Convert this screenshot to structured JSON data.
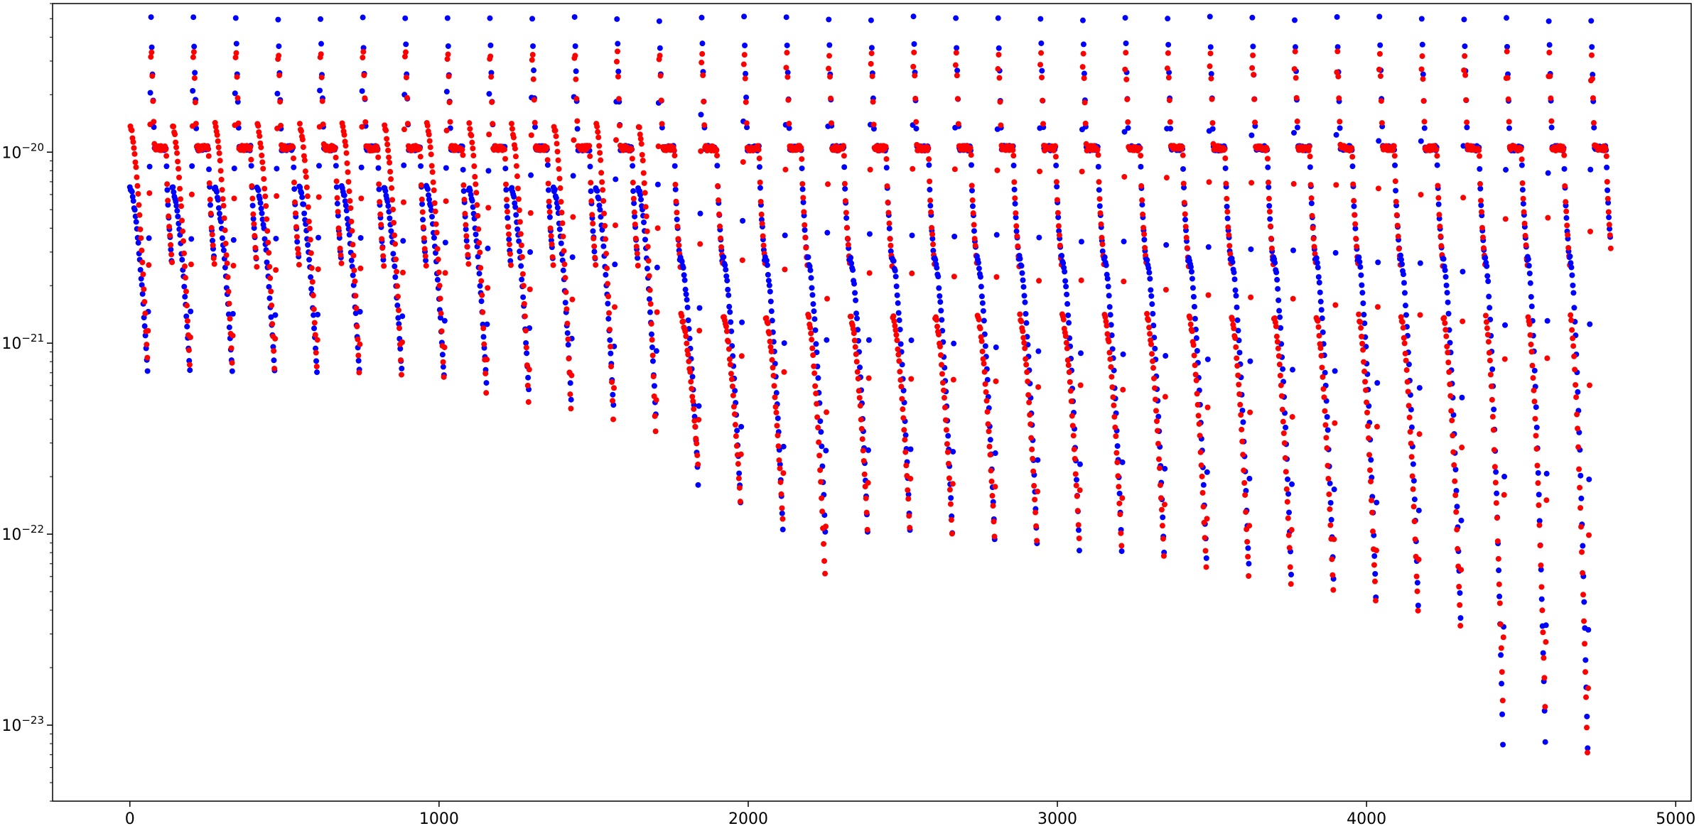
{
  "chart_data": {
    "type": "scatter",
    "title": "",
    "xlabel": "",
    "ylabel": "",
    "xlim": [
      -250,
      5050
    ],
    "ylim": [
      4e-24,
      6e-20
    ],
    "yscale": "log",
    "grid": false,
    "legend": "none",
    "x_ticks": [
      {
        "value": 0,
        "label": "0"
      },
      {
        "value": 1000,
        "label": "1000"
      },
      {
        "value": 2000,
        "label": "2000"
      },
      {
        "value": 3000,
        "label": "3000"
      },
      {
        "value": 4000,
        "label": "4000"
      },
      {
        "value": 5000,
        "label": "5000"
      }
    ],
    "y_ticks": [
      {
        "value": 1e-23,
        "base": "10",
        "exponent": "−23"
      },
      {
        "value": 1e-22,
        "base": "10",
        "exponent": "−22"
      },
      {
        "value": 1e-21,
        "base": "10",
        "exponent": "−21"
      },
      {
        "value": 1e-20,
        "base": "10",
        "exponent": "−20"
      }
    ],
    "series": [
      {
        "color": "#0000ff",
        "marker": "circle"
      },
      {
        "color": "#ff0000",
        "marker": "circle"
      }
    ],
    "blocks": [
      {
        "x0": 0,
        "min_blue": 7e-22,
        "min_red": 7.5e-22
      },
      {
        "x0": 137,
        "min_blue": 7e-22,
        "min_red": 7e-22
      },
      {
        "x0": 274,
        "min_blue": 7e-22,
        "min_red": 7e-22
      },
      {
        "x0": 411,
        "min_blue": 7e-22,
        "min_red": 6.8e-22
      },
      {
        "x0": 548,
        "min_blue": 7e-22,
        "min_red": 6.8e-22
      },
      {
        "x0": 685,
        "min_blue": 7e-22,
        "min_red": 6.5e-22
      },
      {
        "x0": 822,
        "min_blue": 7e-22,
        "min_red": 6.3e-22
      },
      {
        "x0": 959,
        "min_blue": 6.5e-22,
        "min_red": 6e-22
      },
      {
        "x0": 1096,
        "min_blue": 6e-22,
        "min_red": 5e-22
      },
      {
        "x0": 1233,
        "min_blue": 5.5e-22,
        "min_red": 4.5e-22
      },
      {
        "x0": 1370,
        "min_blue": 5e-22,
        "min_red": 4e-22
      },
      {
        "x0": 1507,
        "min_blue": 4.5e-22,
        "min_red": 3.5e-22
      },
      {
        "x0": 1644,
        "min_blue": 4e-22,
        "min_red": 3e-22
      },
      {
        "x0": 1781,
        "min_blue": 1.8e-22,
        "min_red": 2.2e-22
      },
      {
        "x0": 1918,
        "min_blue": 1.4e-22,
        "min_red": 1.4e-22
      },
      {
        "x0": 2055,
        "min_blue": 1e-22,
        "min_red": 1.1e-22
      },
      {
        "x0": 2192,
        "min_blue": 1e-22,
        "min_red": 5.5e-23
      },
      {
        "x0": 2329,
        "min_blue": 1e-22,
        "min_red": 1e-22
      },
      {
        "x0": 2466,
        "min_blue": 1e-22,
        "min_red": 1e-22
      },
      {
        "x0": 2603,
        "min_blue": 9.5e-23,
        "min_red": 9.5e-23
      },
      {
        "x0": 2740,
        "min_blue": 9e-23,
        "min_red": 9e-23
      },
      {
        "x0": 2877,
        "min_blue": 8.5e-23,
        "min_red": 8.5e-23
      },
      {
        "x0": 3014,
        "min_blue": 8e-23,
        "min_red": 8.5e-23
      },
      {
        "x0": 3151,
        "min_blue": 8e-23,
        "min_red": 8e-23
      },
      {
        "x0": 3288,
        "min_blue": 7.5e-23,
        "min_red": 7e-23
      },
      {
        "x0": 3425,
        "min_blue": 7e-23,
        "min_red": 6e-23
      },
      {
        "x0": 3562,
        "min_blue": 6.5e-23,
        "min_red": 5.5e-23
      },
      {
        "x0": 3699,
        "min_blue": 6e-23,
        "min_red": 5e-23
      },
      {
        "x0": 3836,
        "min_blue": 5.5e-23,
        "min_red": 4.5e-23
      },
      {
        "x0": 3973,
        "min_blue": 4.5e-23,
        "min_red": 4e-23
      },
      {
        "x0": 4110,
        "min_blue": 4e-23,
        "min_red": 3.5e-23
      },
      {
        "x0": 4247,
        "min_blue": 3.5e-23,
        "min_red": 3e-23
      },
      {
        "x0": 4384,
        "min_blue": 7.5e-24,
        "min_red": 1.2e-23
      },
      {
        "x0": 4521,
        "min_blue": 7.5e-24,
        "min_red": 1.1e-23
      },
      {
        "x0": 4658,
        "min_blue": 7e-24,
        "min_red": 6e-24
      }
    ]
  }
}
